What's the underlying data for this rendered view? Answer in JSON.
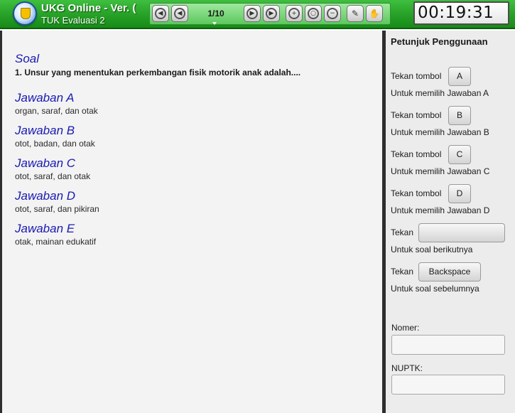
{
  "header": {
    "app_title": "UKG Online - Ver. (",
    "subtitle": "TUK Evaluasi 2",
    "page_indicator": "1/10",
    "timer": "00:19:31"
  },
  "toolbar": {
    "buttons": [
      {
        "name": "first-icon",
        "glyph": "◀"
      },
      {
        "name": "prev-icon",
        "glyph": "◀"
      },
      {
        "name": "next-icon",
        "glyph": "▶"
      },
      {
        "name": "last-icon",
        "glyph": "▶"
      },
      {
        "name": "zoom-in-icon",
        "glyph": "+"
      },
      {
        "name": "zoom-reset-icon",
        "glyph": "○"
      },
      {
        "name": "zoom-out-icon",
        "glyph": "−"
      },
      {
        "name": "flag-icon",
        "glyph": "✎"
      },
      {
        "name": "hand-icon",
        "glyph": "✋"
      }
    ]
  },
  "question": {
    "heading": "Soal",
    "text": "1. Unsur yang menentukan perkembangan fisik motorik anak adalah....",
    "answers": [
      {
        "label": "Jawaban A",
        "text": "organ, saraf, dan otak"
      },
      {
        "label": "Jawaban B",
        "text": "otot, badan, dan otak"
      },
      {
        "label": "Jawaban C",
        "text": "otot, saraf, dan otak"
      },
      {
        "label": "Jawaban D",
        "text": "otot, saraf, dan pikiran"
      },
      {
        "label": "Jawaban E",
        "text": "otak, mainan edukatif"
      }
    ]
  },
  "sidebar": {
    "title": "Petunjuk Penggunaan",
    "instructions": [
      {
        "prefix": "Tekan tombol",
        "key": "A",
        "desc": "Untuk memilih Jawaban A"
      },
      {
        "prefix": "Tekan tombol",
        "key": "B",
        "desc": "Untuk memilih Jawaban B"
      },
      {
        "prefix": "Tekan tombol",
        "key": "C",
        "desc": "Untuk memilih Jawaban C"
      },
      {
        "prefix": "Tekan tombol",
        "key": "D",
        "desc": "Untuk memilih Jawaban D"
      },
      {
        "prefix": "Tekan",
        "key": "",
        "desc": "Untuk soal berikutnya"
      },
      {
        "prefix": "Tekan",
        "key": "Backspace",
        "desc": "Untuk soal sebelumnya"
      }
    ],
    "nomer_label": "Nomer:",
    "nomer_value": "",
    "nuptk_label": "NUPTK:",
    "nuptk_value": ""
  },
  "colors": {
    "toolbar_green": "#2aa52a",
    "answer_label_blue": "#1a1ab3"
  }
}
